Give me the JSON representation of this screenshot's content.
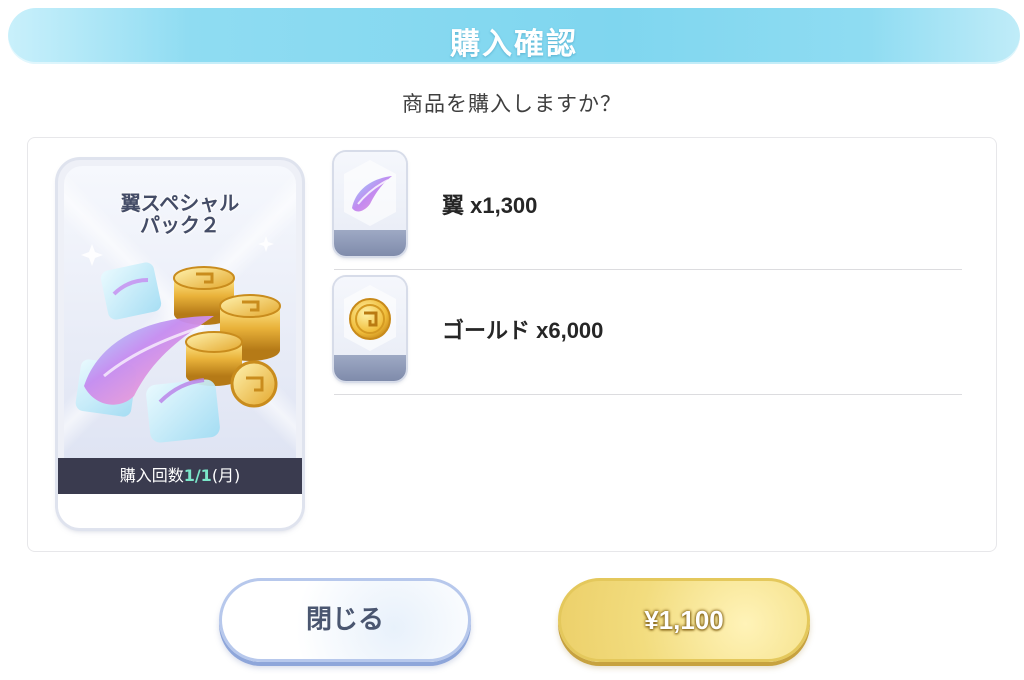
{
  "dialog": {
    "title": "購入確認",
    "subtitle": "商品を購入しますか？"
  },
  "product_card": {
    "name_line1": "翼スペシャル",
    "name_line2": "パック２",
    "purchase_count_label": "購入回数",
    "purchase_count_value": "1/1",
    "purchase_period": "(月)",
    "art_icon": "wings-and-gold-coins-pack-art"
  },
  "items": [
    {
      "icon": "wing-feather-icon",
      "label": "翼 x1,300"
    },
    {
      "icon": "gold-coin-icon",
      "label": "ゴールド x6,000"
    }
  ],
  "buttons": {
    "close_label": "閉じる",
    "buy_label": "¥1,100"
  },
  "colors": {
    "title_bar": "#7fd6ef",
    "card_footer": "#3a3b4f",
    "count_highlight": "#7be6c9",
    "buy_button": "#f2dc7e",
    "close_button_border": "#b7c8ec"
  }
}
